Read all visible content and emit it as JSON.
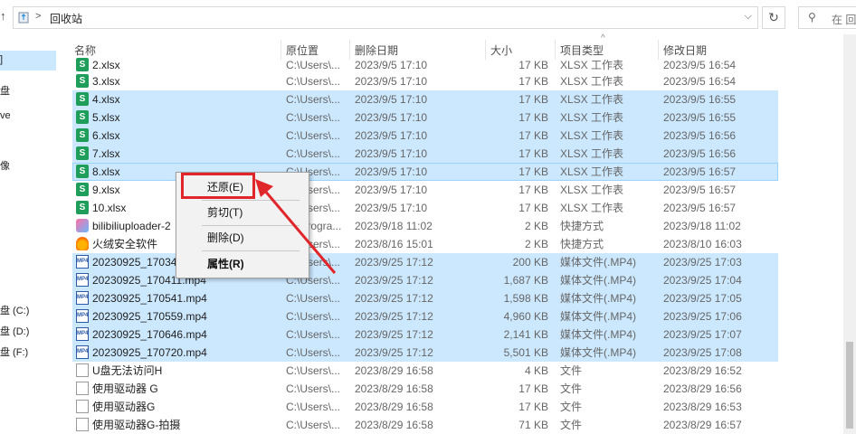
{
  "address": {
    "path": "回收站"
  },
  "search": {
    "placeholder": "在 回"
  },
  "nav": {
    "items": [
      "]",
      "盘",
      "ve",
      "像",
      "盘 (C:)",
      "盘 (D:)",
      "盘 (F:)"
    ]
  },
  "columns": {
    "name": "名称",
    "location": "原位置",
    "deleted": "删除日期",
    "size": "大小",
    "type": "项目类型",
    "modified": "修改日期"
  },
  "rows": [
    {
      "name": "2.xlsx",
      "loc": "C:\\Users\\...",
      "del": "2023/9/5 17:10",
      "size": "17 KB",
      "type": "XLSX 工作表",
      "mod": "2023/9/5 16:54",
      "icon": "xlsx",
      "state": ""
    },
    {
      "name": "3.xlsx",
      "loc": "C:\\Users\\...",
      "del": "2023/9/5 17:10",
      "size": "17 KB",
      "type": "XLSX 工作表",
      "mod": "2023/9/5 16:54",
      "icon": "xlsx",
      "state": ""
    },
    {
      "name": "4.xlsx",
      "loc": "C:\\Users\\...",
      "del": "2023/9/5 17:10",
      "size": "17 KB",
      "type": "XLSX 工作表",
      "mod": "2023/9/5 16:55",
      "icon": "xlsx",
      "state": "sel"
    },
    {
      "name": "5.xlsx",
      "loc": "C:\\Users\\...",
      "del": "2023/9/5 17:10",
      "size": "17 KB",
      "type": "XLSX 工作表",
      "mod": "2023/9/5 16:55",
      "icon": "xlsx",
      "state": "sel"
    },
    {
      "name": "6.xlsx",
      "loc": "C:\\Users\\...",
      "del": "2023/9/5 17:10",
      "size": "17 KB",
      "type": "XLSX 工作表",
      "mod": "2023/9/5 16:56",
      "icon": "xlsx",
      "state": "sel"
    },
    {
      "name": "7.xlsx",
      "loc": "C:\\Users\\...",
      "del": "2023/9/5 17:10",
      "size": "17 KB",
      "type": "XLSX 工作表",
      "mod": "2023/9/5 16:56",
      "icon": "xlsx",
      "state": "sel"
    },
    {
      "name": "8.xlsx",
      "loc": "C:\\Users\\...",
      "del": "2023/9/5 17:10",
      "size": "17 KB",
      "type": "XLSX 工作表",
      "mod": "2023/9/5 16:57",
      "icon": "xlsx",
      "state": "focus"
    },
    {
      "name": "9.xlsx",
      "loc": "C:\\Users\\...",
      "del": "2023/9/5 17:10",
      "size": "17 KB",
      "type": "XLSX 工作表",
      "mod": "2023/9/5 16:57",
      "icon": "xlsx",
      "state": ""
    },
    {
      "name": "10.xlsx",
      "loc": "C:\\Users\\...",
      "del": "2023/9/5 17:10",
      "size": "17 KB",
      "type": "XLSX 工作表",
      "mod": "2023/9/5 16:57",
      "icon": "xlsx",
      "state": ""
    },
    {
      "name": "bilibiliuploader-2",
      "loc": "C:\\Progra...",
      "del": "2023/9/18 11:02",
      "size": "2 KB",
      "type": "快捷方式",
      "mod": "2023/9/18 11:02",
      "icon": "lnk",
      "state": ""
    },
    {
      "name": "火绒安全软件",
      "loc": "C:\\Users\\...",
      "del": "2023/8/16 15:01",
      "size": "2 KB",
      "type": "快捷方式",
      "mod": "2023/8/10 16:03",
      "icon": "fire",
      "state": ""
    },
    {
      "name": "20230925_17034",
      "loc": "C:\\Users\\...",
      "del": "2023/9/25 17:12",
      "size": "200 KB",
      "type": "媒体文件(.MP4)",
      "mod": "2023/9/25 17:03",
      "icon": "mp4",
      "state": "sel"
    },
    {
      "name": "20230925_170411.mp4",
      "loc": "C:\\Users\\...",
      "del": "2023/9/25 17:12",
      "size": "1,687 KB",
      "type": "媒体文件(.MP4)",
      "mod": "2023/9/25 17:04",
      "icon": "mp4",
      "state": "sel"
    },
    {
      "name": "20230925_170541.mp4",
      "loc": "C:\\Users\\...",
      "del": "2023/9/25 17:12",
      "size": "1,598 KB",
      "type": "媒体文件(.MP4)",
      "mod": "2023/9/25 17:05",
      "icon": "mp4",
      "state": "sel"
    },
    {
      "name": "20230925_170559.mp4",
      "loc": "C:\\Users\\...",
      "del": "2023/9/25 17:12",
      "size": "4,960 KB",
      "type": "媒体文件(.MP4)",
      "mod": "2023/9/25 17:06",
      "icon": "mp4",
      "state": "sel"
    },
    {
      "name": "20230925_170646.mp4",
      "loc": "C:\\Users\\...",
      "del": "2023/9/25 17:12",
      "size": "2,141 KB",
      "type": "媒体文件(.MP4)",
      "mod": "2023/9/25 17:07",
      "icon": "mp4",
      "state": "sel"
    },
    {
      "name": "20230925_170720.mp4",
      "loc": "C:\\Users\\...",
      "del": "2023/9/25 17:12",
      "size": "5,501 KB",
      "type": "媒体文件(.MP4)",
      "mod": "2023/9/25 17:08",
      "icon": "mp4",
      "state": "sel"
    },
    {
      "name": "U盘无法访问H",
      "loc": "C:\\Users\\...",
      "del": "2023/8/29 16:58",
      "size": "4 KB",
      "type": "文件",
      "mod": "2023/8/29 16:52",
      "icon": "file",
      "state": ""
    },
    {
      "name": "使用驱动器 G",
      "loc": "C:\\Users\\...",
      "del": "2023/8/29 16:58",
      "size": "17 KB",
      "type": "文件",
      "mod": "2023/8/29 16:56",
      "icon": "file",
      "state": ""
    },
    {
      "name": "使用驱动器G",
      "loc": "C:\\Users\\...",
      "del": "2023/8/29 16:58",
      "size": "17 KB",
      "type": "文件",
      "mod": "2023/8/29 16:53",
      "icon": "file",
      "state": ""
    },
    {
      "name": "使用驱动器G-拍摄",
      "loc": "C:\\Users\\...",
      "del": "2023/8/29 16:58",
      "size": "71 KB",
      "type": "文件",
      "mod": "2023/8/29 16:57",
      "icon": "file",
      "state": ""
    }
  ],
  "icons": {
    "xlsx": "S",
    "mp4": "MP4"
  },
  "context_menu": {
    "restore": "还原(E)",
    "cut": "剪切(T)",
    "delete": "删除(D)",
    "properties": "属性(R)"
  },
  "colors": {
    "selection": "#cce8ff",
    "highlight": "#e0262b"
  }
}
